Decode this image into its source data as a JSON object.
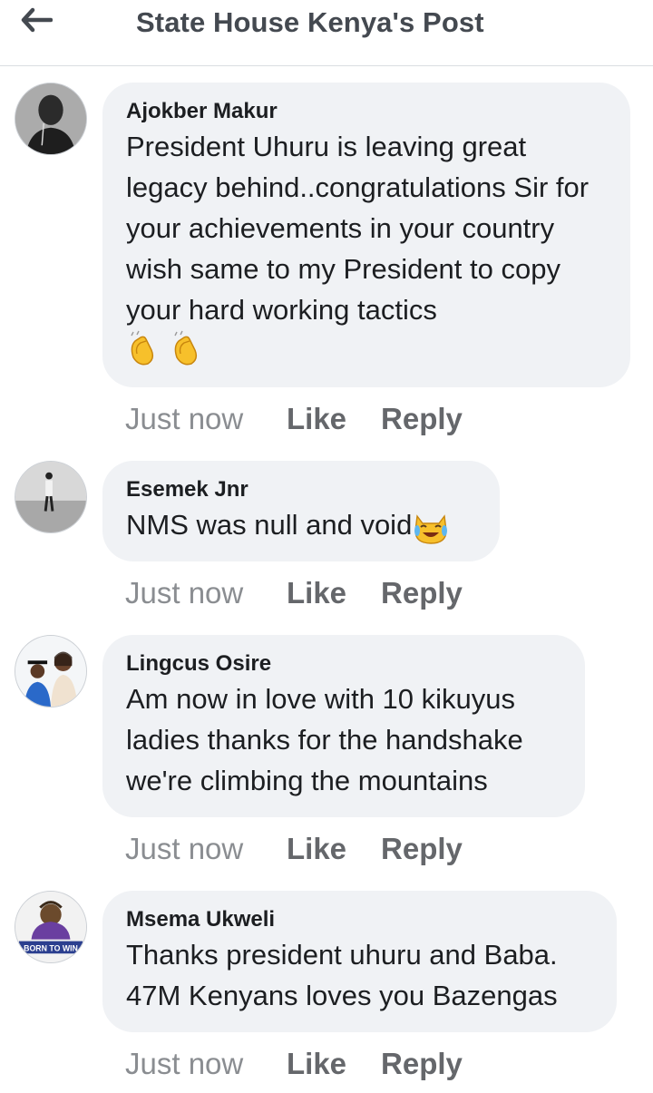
{
  "header": {
    "title": "State House Kenya's Post"
  },
  "comments": [
    {
      "author": "Ajokber Makur",
      "text": "President Uhuru is leaving great legacy behind..congratulations Sir for your achievements in your country wish same to my President to copy your hard working tactics",
      "emoji": "clapping-hands-icon",
      "timestamp": "Just now",
      "like_label": "Like",
      "reply_label": "Reply"
    },
    {
      "author": "Esemek Jnr",
      "text": "NMS was null and void",
      "emoji": "cat-tears-of-joy-icon",
      "timestamp": "Just now",
      "like_label": "Like",
      "reply_label": "Reply"
    },
    {
      "author": "Lingcus Osire",
      "text": "Am now in love with 10 kikuyus ladies thanks for the handshake we're climbing the mountains",
      "timestamp": "Just now",
      "like_label": "Like",
      "reply_label": "Reply"
    },
    {
      "author": "Msema Ukweli",
      "text": "Thanks president uhuru and Baba. 47M Kenyans loves you Bazengas",
      "avatar_text": "BORN TO WIN",
      "timestamp": "Just now",
      "like_label": "Like",
      "reply_label": "Reply"
    }
  ],
  "colors": {
    "bubble": "#f0f2f5",
    "action_text": "#65676b",
    "timestamp": "#8a8d91",
    "title": "#444950"
  }
}
